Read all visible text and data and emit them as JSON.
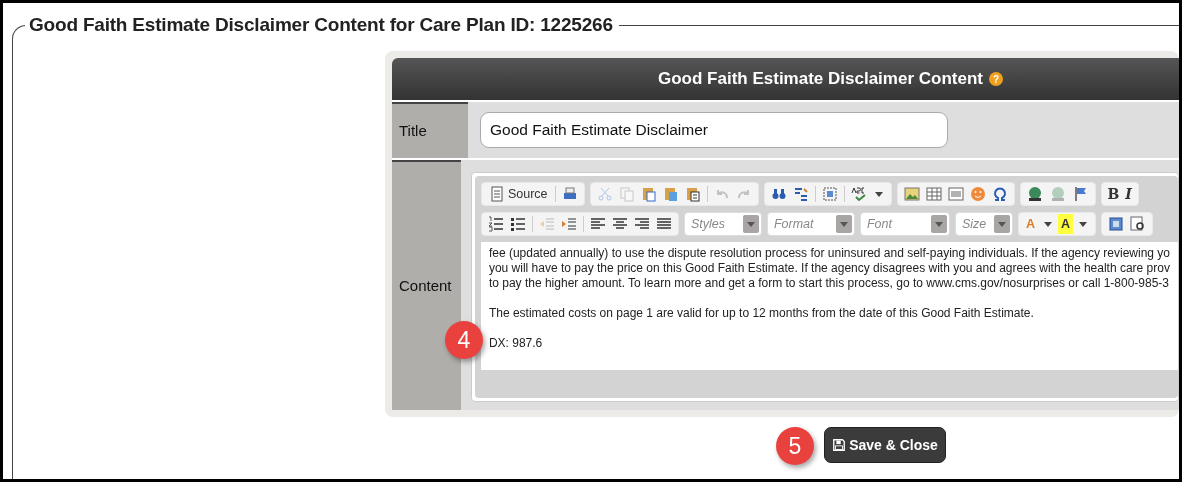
{
  "fieldset": {
    "legend": "Good Faith Estimate Disclaimer Content for Care Plan ID: 1225266"
  },
  "panel": {
    "title": "Good Faith Estimate Disclaimer Content",
    "help_icon": "?",
    "rows": [
      {
        "kind": "input",
        "label": "Title",
        "value": "Good Faith Estimate Disclaimer"
      },
      {
        "kind": "editor",
        "label": "Content"
      }
    ]
  },
  "editor": {
    "source_label": "Source",
    "bold": "B",
    "italic": "I",
    "combos": [
      {
        "placeholder": "Styles"
      },
      {
        "placeholder": "Format"
      },
      {
        "placeholder": "Font"
      },
      {
        "placeholder": "Size"
      }
    ],
    "text_color": "A",
    "bg_color": "A",
    "paragraphs": [
      [
        "fee (updated annually) to use the dispute resolution process for uninsured and self-paying individuals. If the agency reviewing yo",
        "you will have to pay the price on this Good Faith Estimate. If the agency disagrees with you and agrees with the health care prov",
        "to pay the higher amount. To learn more and get a form to start this process, go to www.cms.gov/nosurprises or call 1-800-985-3"
      ],
      [
        "The estimated costs on page 1 are valid for up to 12 months from the date of this Good Faith Estimate."
      ],
      [
        "DX: 987.6"
      ]
    ]
  },
  "callouts": [
    {
      "number": "4"
    },
    {
      "number": "5"
    }
  ],
  "save_button": {
    "label": "Save & Close"
  }
}
